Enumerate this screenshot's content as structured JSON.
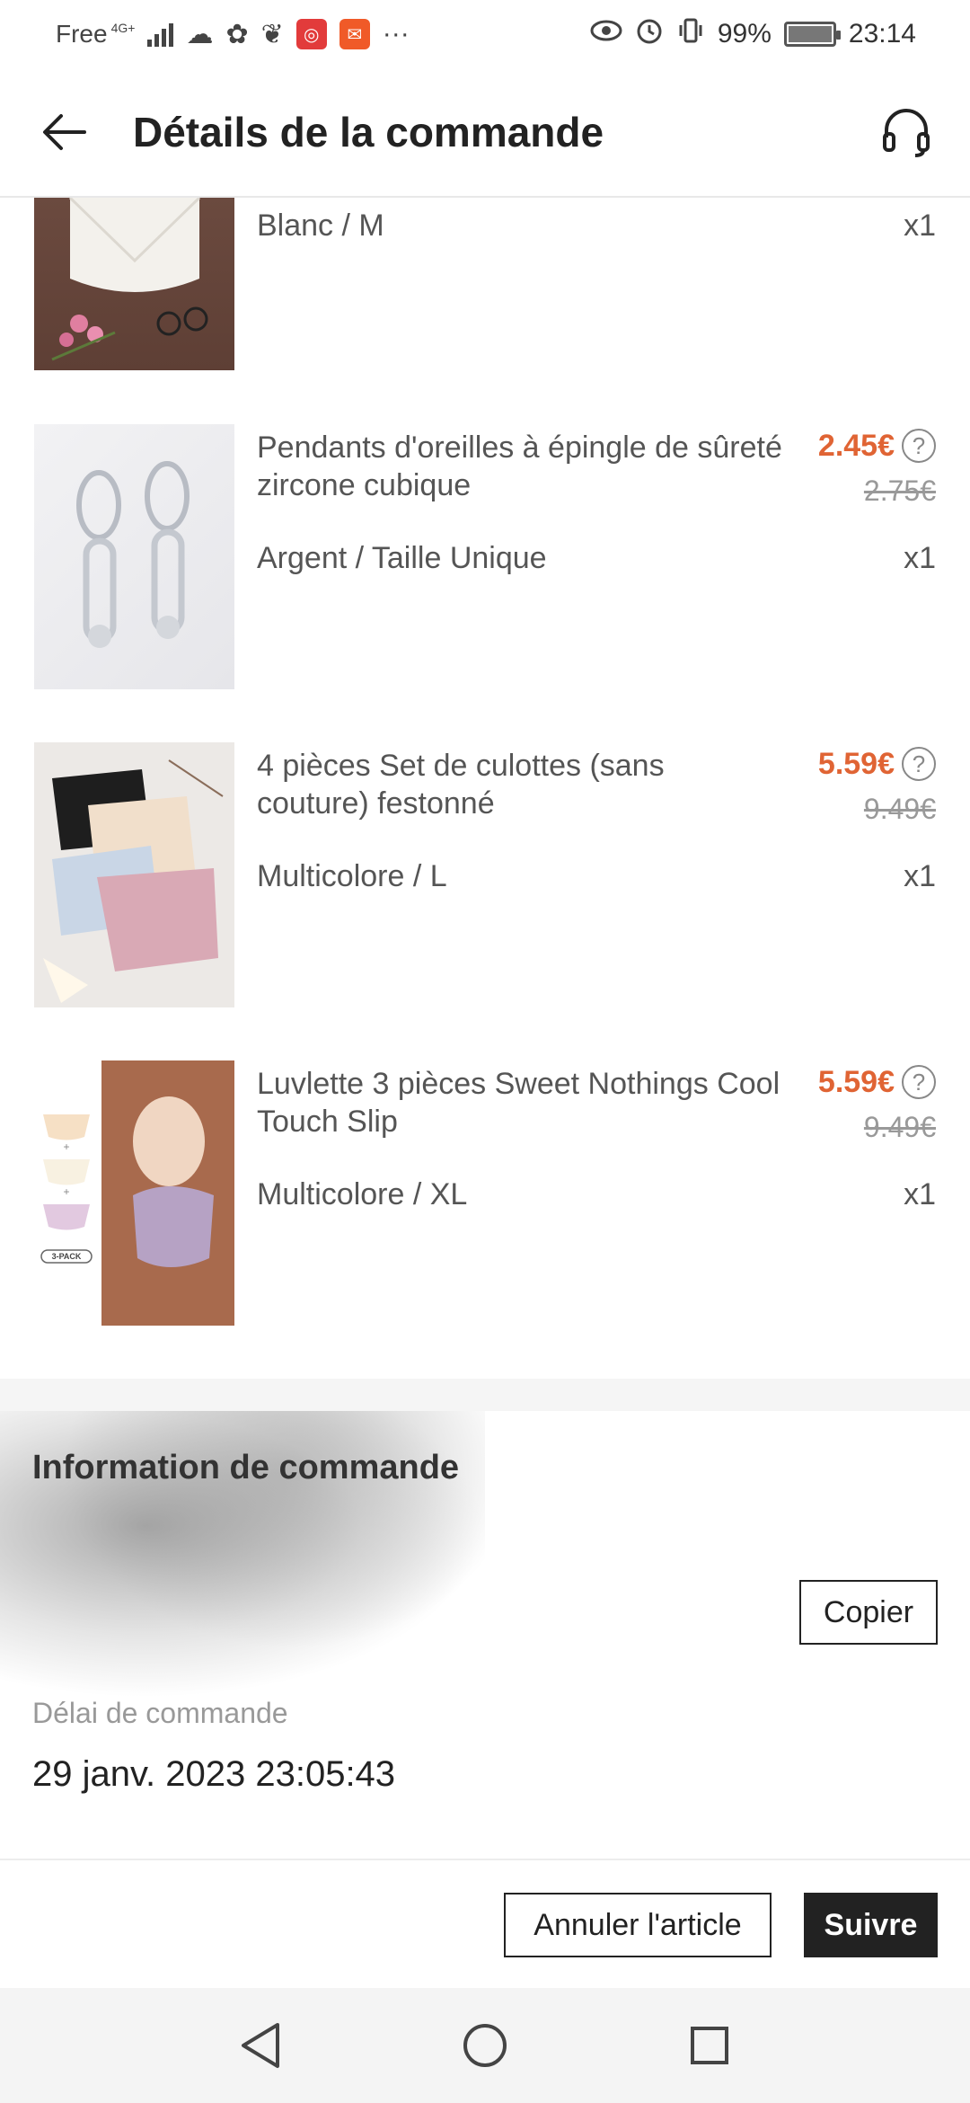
{
  "status_bar": {
    "carrier": "Free",
    "network": "4G+",
    "battery": "99%",
    "time": "23:14",
    "more": "···"
  },
  "header": {
    "title": "Détails de la commande"
  },
  "items": [
    {
      "name": "",
      "variant": "Blanc / M",
      "qty": "x1"
    },
    {
      "name": "Pendants d'oreilles à épingle de sûreté zircone cubique",
      "price": "2.45€",
      "old_price": "2.75€",
      "variant": "Argent / Taille Unique",
      "qty": "x1"
    },
    {
      "name": "4 pièces Set de culottes (sans couture) festonné",
      "price": "5.59€",
      "old_price": "9.49€",
      "variant": "Multicolore / L",
      "qty": "x1"
    },
    {
      "name": "Luvlette 3 pièces Sweet Nothings Cool Touch Slip",
      "price": "5.59€",
      "old_price": "9.49€",
      "variant": "Multicolore / XL",
      "qty": "x1",
      "pack_label": "3-PACK"
    }
  ],
  "order_info": {
    "title": "Information de commande",
    "copy_label": "Copier",
    "date_label": "Délai de commande",
    "date_value": "29 janv. 2023 23:05:43"
  },
  "actions": {
    "cancel_label": "Annuler l'article",
    "follow_label": "Suivre"
  },
  "colors": {
    "price": "#e06434",
    "primary_button": "#222222"
  }
}
